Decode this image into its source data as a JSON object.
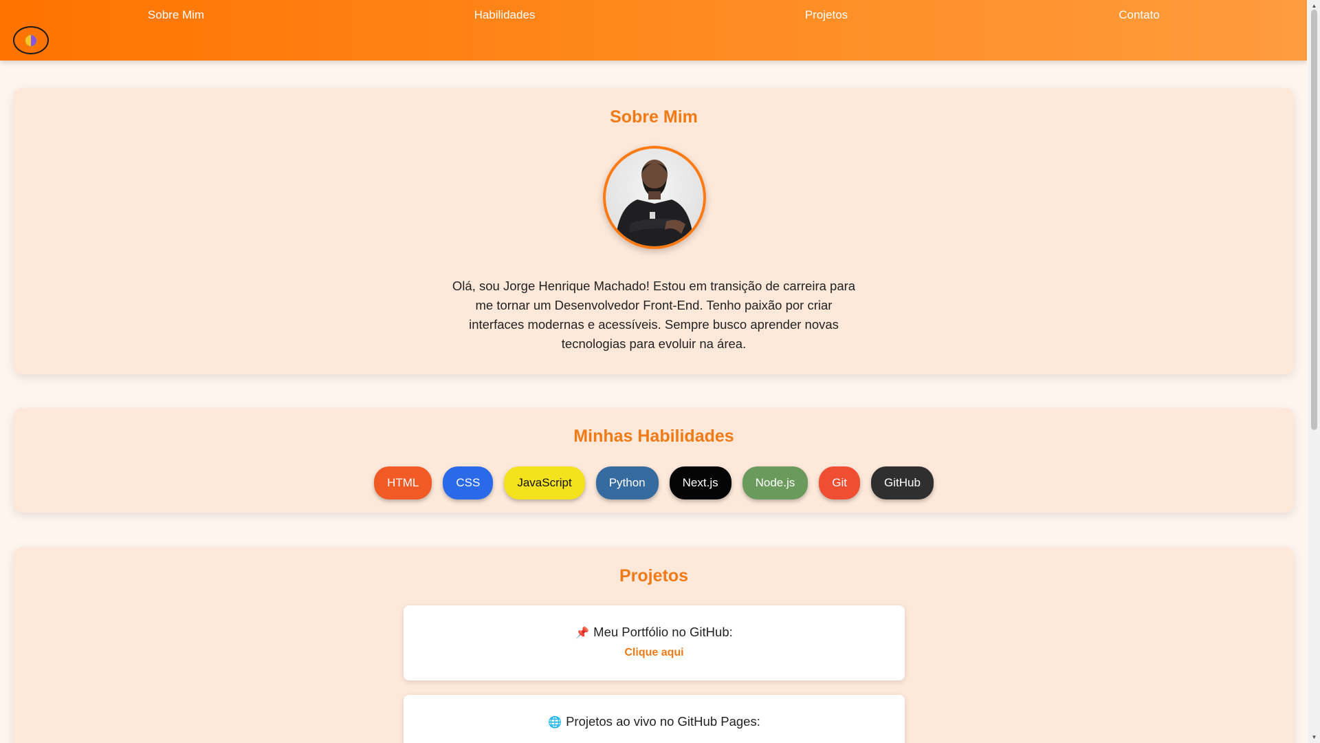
{
  "nav": {
    "links": [
      "Sobre Mim",
      "Habilidades",
      "Projetos",
      "Contato"
    ],
    "theme_toggle_icon": "half-moon-contrast-icon"
  },
  "about": {
    "title": "Sobre Mim",
    "avatar_icon": "profile-photo",
    "lines": [
      "Olá, sou Jorge Henrique Machado! Estou em transição de carreira para",
      "me tornar um Desenvolvedor Front-End. Tenho paixão por criar",
      "interfaces modernas e acessíveis. Sempre busco aprender novas",
      "tecnologias para evoluir na área."
    ]
  },
  "skills": {
    "title": "Minhas Habilidades",
    "chips": [
      {
        "label": "HTML",
        "bg": "#f15a24",
        "fg": "#ffffff"
      },
      {
        "label": "CSS",
        "bg": "#2a6ae9",
        "fg": "#ffffff"
      },
      {
        "label": "JavaScript",
        "bg": "#f3e21c",
        "fg": "#111111"
      },
      {
        "label": "Python",
        "bg": "#356b9e",
        "fg": "#ffffff"
      },
      {
        "label": "Next.js",
        "bg": "#050505",
        "fg": "#ffffff"
      },
      {
        "label": "Node.js",
        "bg": "#6a9a5c",
        "fg": "#ffffff"
      },
      {
        "label": "Git",
        "bg": "#f04e32",
        "fg": "#ffffff"
      },
      {
        "label": "GitHub",
        "bg": "#2f2f2f",
        "fg": "#ffffff"
      }
    ]
  },
  "projects": {
    "title": "Projetos",
    "items": [
      {
        "icon": "pin-icon",
        "emoji": "📌",
        "text": "Meu Portfólio no GitHub:",
        "link": "Clique aqui"
      },
      {
        "icon": "globe-icon",
        "emoji": "🌐",
        "text": "Projetos ao vivo no GitHub Pages:",
        "link": ""
      }
    ]
  },
  "colors": {
    "accent": "#f07a16",
    "nav_gradient_start": "#ff7300",
    "nav_gradient_end": "#ff9c3e",
    "section_bg": "#fde8da",
    "page_bg": "#fff5ef"
  }
}
